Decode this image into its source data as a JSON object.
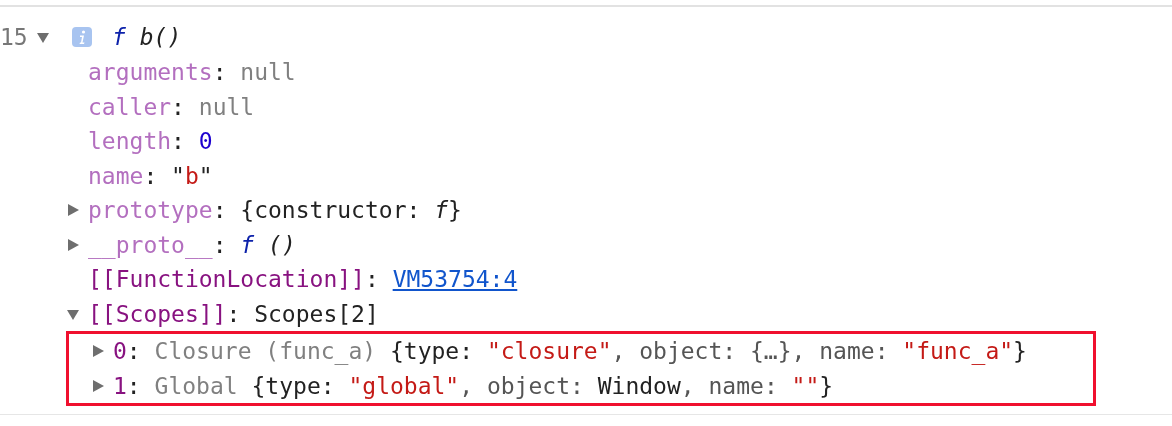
{
  "console": {
    "entries": [
      {
        "line_number": "15",
        "expanded": true,
        "info_badge": true,
        "label": [
          {
            "text": "f",
            "kind": "fn"
          },
          {
            "text": " b()",
            "kind": "italic"
          }
        ],
        "properties": [
          {
            "expandable": false,
            "segments": [
              {
                "text": "arguments",
                "kind": "key"
              },
              {
                "text": ": ",
                "kind": "punct"
              },
              {
                "text": "null",
                "kind": "null"
              }
            ]
          },
          {
            "expandable": false,
            "segments": [
              {
                "text": "caller",
                "kind": "key"
              },
              {
                "text": ": ",
                "kind": "punct"
              },
              {
                "text": "null",
                "kind": "null"
              }
            ]
          },
          {
            "expandable": false,
            "segments": [
              {
                "text": "length",
                "kind": "key"
              },
              {
                "text": ": ",
                "kind": "punct"
              },
              {
                "text": "0",
                "kind": "number"
              }
            ]
          },
          {
            "expandable": false,
            "segments": [
              {
                "text": "name",
                "kind": "key"
              },
              {
                "text": ": \"",
                "kind": "punct"
              },
              {
                "text": "b",
                "kind": "string"
              },
              {
                "text": "\"",
                "kind": "punct"
              }
            ]
          },
          {
            "expandable": true,
            "expanded": false,
            "segments": [
              {
                "text": "prototype",
                "kind": "key"
              },
              {
                "text": ": {constructor: ",
                "kind": "punct"
              },
              {
                "text": "f",
                "kind": "italic"
              },
              {
                "text": "}",
                "kind": "punct"
              }
            ]
          },
          {
            "expandable": true,
            "expanded": false,
            "segments": [
              {
                "text": "__proto__",
                "kind": "key"
              },
              {
                "text": ": ",
                "kind": "punct"
              },
              {
                "text": "f",
                "kind": "fn"
              },
              {
                "text": " ()",
                "kind": "italic"
              }
            ]
          },
          {
            "expandable": false,
            "segments": [
              {
                "text": "[[FunctionLocation]]",
                "kind": "internal"
              },
              {
                "text": ": ",
                "kind": "punct"
              },
              {
                "text": "VM53754:4",
                "kind": "link"
              }
            ]
          },
          {
            "expandable": true,
            "expanded": true,
            "highlighted": true,
            "segments": [
              {
                "text": "[[Scopes]]",
                "kind": "internal"
              },
              {
                "text": ": Scopes[2]",
                "kind": "punct"
              }
            ],
            "children": [
              {
                "expandable": true,
                "expanded": false,
                "segments": [
                  {
                    "text": "0",
                    "kind": "internal"
                  },
                  {
                    "text": ": ",
                    "kind": "punct"
                  },
                  {
                    "text": "Closure (func_a)",
                    "kind": "null"
                  },
                  {
                    "text": " {type: ",
                    "kind": "punct"
                  },
                  {
                    "text": "\"closure\"",
                    "kind": "string"
                  },
                  {
                    "text": ", object: {…}, name: ",
                    "kind": "dim"
                  },
                  {
                    "text": "\"func_a\"",
                    "kind": "string"
                  },
                  {
                    "text": "}",
                    "kind": "punct"
                  }
                ]
              },
              {
                "expandable": true,
                "expanded": false,
                "segments": [
                  {
                    "text": "1",
                    "kind": "internal"
                  },
                  {
                    "text": ": ",
                    "kind": "punct"
                  },
                  {
                    "text": "Global",
                    "kind": "null"
                  },
                  {
                    "text": " {type: ",
                    "kind": "punct"
                  },
                  {
                    "text": "\"global\"",
                    "kind": "string"
                  },
                  {
                    "text": ", object: ",
                    "kind": "dim"
                  },
                  {
                    "text": "Window",
                    "kind": "punct"
                  },
                  {
                    "text": ", name: ",
                    "kind": "dim"
                  },
                  {
                    "text": "\"\"",
                    "kind": "string"
                  },
                  {
                    "text": "}",
                    "kind": "punct"
                  }
                ]
              }
            ]
          }
        ]
      }
    ]
  }
}
